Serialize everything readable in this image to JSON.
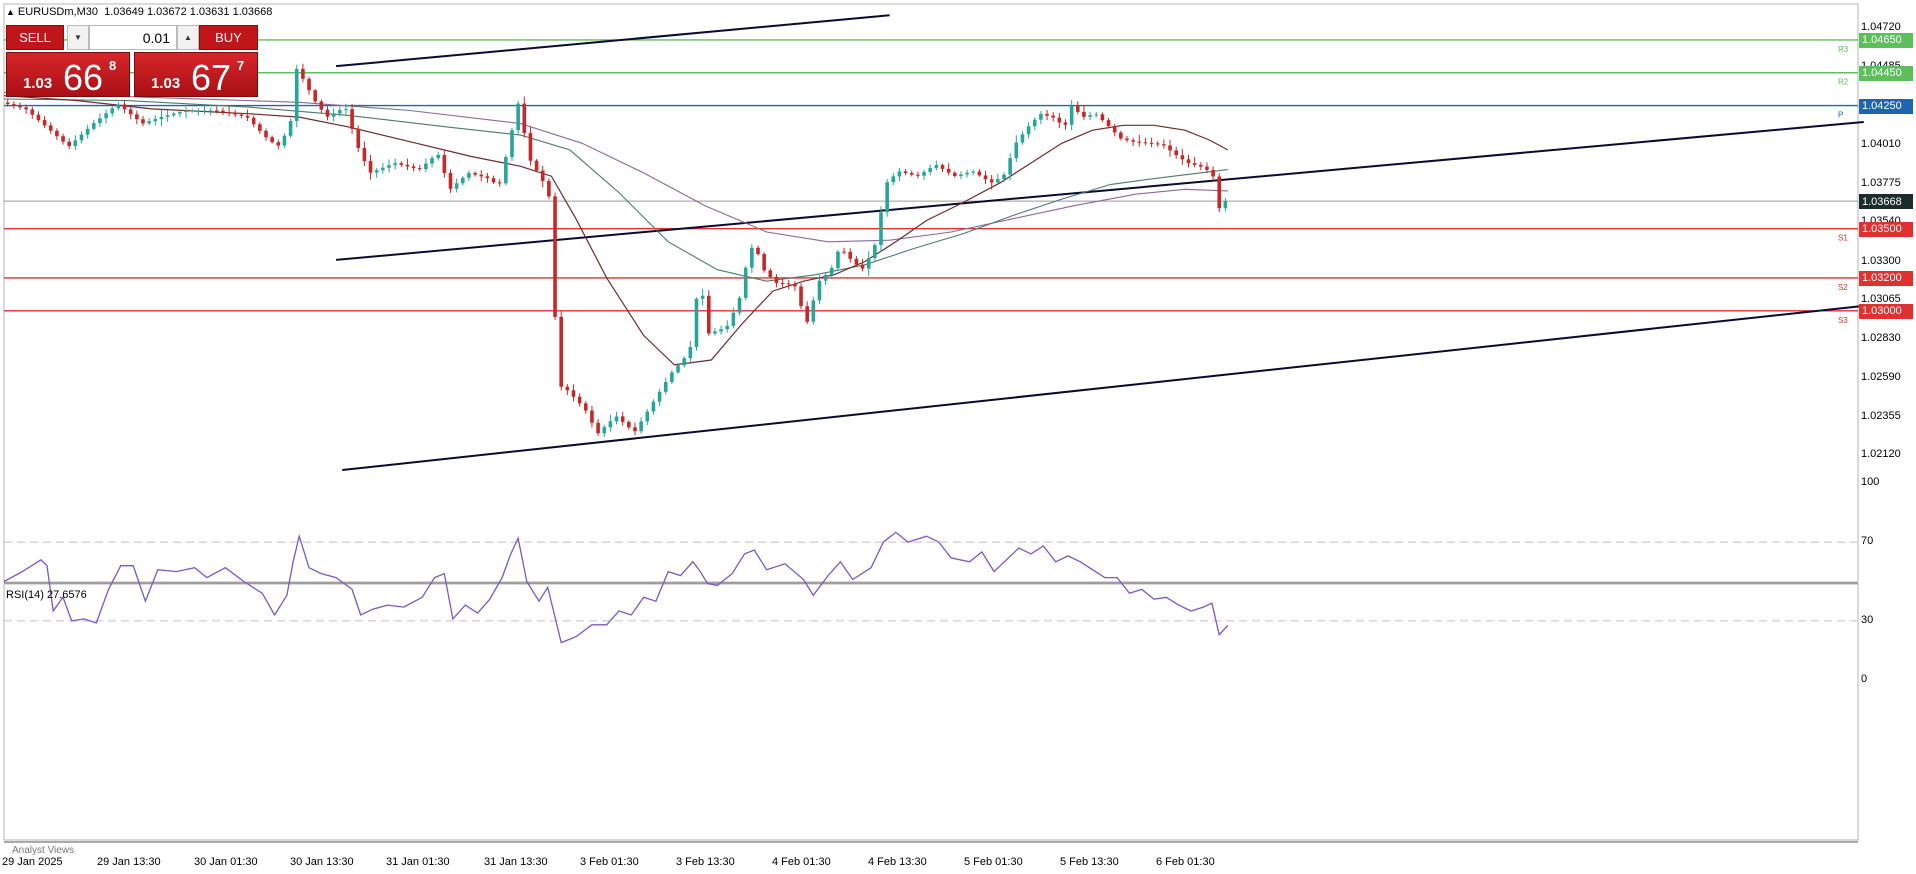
{
  "symbol": {
    "name_tf": "EURUSDm,M30",
    "ohlc": "1.03649 1.03672 1.03631 1.03668"
  },
  "trade_panel": {
    "sell_label": "SELL",
    "buy_label": "BUY",
    "volume": "0.01",
    "bid": {
      "pre": "1.03",
      "big": "66",
      "sup": "8"
    },
    "ask": {
      "pre": "1.03",
      "big": "67",
      "sup": "7"
    }
  },
  "colors": {
    "bull": "#26a69a",
    "bear": "#c62828",
    "resistance": "#5cbf5c",
    "pivot": "#1e64b4",
    "support": "#e03030",
    "channel": "#0a0a32",
    "rsi": "#7e57c2",
    "ma_fast": "#6d2b2b",
    "ma_mid": "#4e7a6c",
    "ma_slow": "#8a6a9a"
  },
  "price_axis": {
    "ticks": [
      "1.04720",
      "1.04485",
      "1.04010",
      "1.03775",
      "1.03540",
      "1.03300",
      "1.03065",
      "1.02830",
      "1.02590",
      "1.02355",
      "1.02120"
    ]
  },
  "levels": [
    {
      "price": 1.0465,
      "label": "1.04650",
      "kind": "resistance",
      "tag": "R3"
    },
    {
      "price": 1.0445,
      "label": "1.04450",
      "kind": "resistance",
      "tag": "R2"
    },
    {
      "price": 1.0425,
      "label": "1.04250",
      "kind": "pivot",
      "tag": "P"
    },
    {
      "price": 1.035,
      "label": "1.03500",
      "kind": "support",
      "tag": "S1"
    },
    {
      "price": 1.032,
      "label": "1.03200",
      "kind": "support",
      "tag": "S2"
    },
    {
      "price": 1.03,
      "label": "1.03000",
      "kind": "support",
      "tag": "S3"
    }
  ],
  "current_price": {
    "price": 1.03668,
    "label": "1.03668"
  },
  "time_axis": {
    "ticks": [
      "29 Jan 2025",
      "29 Jan 13:30",
      "30 Jan 01:30",
      "30 Jan 13:30",
      "31 Jan 01:30",
      "31 Jan 13:30",
      "3 Feb 01:30",
      "3 Feb 13:30",
      "4 Feb 01:30",
      "4 Feb 13:30",
      "5 Feb 01:30",
      "5 Feb 13:30",
      "6 Feb 01:30"
    ]
  },
  "rsi": {
    "label": "RSI(14) 27.6576",
    "axis_ticks": [
      "100",
      "70",
      "30",
      "0"
    ],
    "levels": [
      70,
      30
    ]
  },
  "footer": {
    "analyst_views": "Analyst Views"
  },
  "chart_data": {
    "type": "candlestick",
    "symbol": "EURUSDm",
    "timeframe": "M30",
    "ylim": [
      1.0203,
      1.0482
    ],
    "price_path": [
      [
        0,
        1.0427
      ],
      [
        20,
        1.0423
      ],
      [
        40,
        1.041
      ],
      [
        55,
        1.04
      ],
      [
        75,
        1.0414
      ],
      [
        95,
        1.0426
      ],
      [
        115,
        1.0414
      ],
      [
        130,
        1.0418
      ],
      [
        150,
        1.0422
      ],
      [
        175,
        1.0422
      ],
      [
        200,
        1.0418
      ],
      [
        215,
        1.0406
      ],
      [
        225,
        1.04
      ],
      [
        235,
        1.0412
      ],
      [
        240,
        1.0448
      ],
      [
        245,
        1.0442
      ],
      [
        255,
        1.0428
      ],
      [
        265,
        1.0418
      ],
      [
        280,
        1.0424
      ],
      [
        290,
        1.04
      ],
      [
        300,
        1.0384
      ],
      [
        320,
        1.039
      ],
      [
        340,
        1.0386
      ],
      [
        355,
        1.0396
      ],
      [
        365,
        1.0374
      ],
      [
        380,
        1.0384
      ],
      [
        395,
        1.0381
      ],
      [
        405,
        1.0376
      ],
      [
        415,
        1.0408
      ],
      [
        420,
        1.0428
      ],
      [
        430,
        1.0392
      ],
      [
        440,
        1.038
      ],
      [
        448,
        1.0365
      ],
      [
        452,
        1.0255
      ],
      [
        460,
        1.0252
      ],
      [
        475,
        1.024
      ],
      [
        485,
        1.0225
      ],
      [
        500,
        1.0236
      ],
      [
        515,
        1.0226
      ],
      [
        530,
        1.0244
      ],
      [
        545,
        1.0262
      ],
      [
        560,
        1.0275
      ],
      [
        568,
        1.0322
      ],
      [
        575,
        1.0286
      ],
      [
        590,
        1.029
      ],
      [
        600,
        1.0306
      ],
      [
        605,
        1.0325
      ],
      [
        612,
        1.0342
      ],
      [
        620,
        1.0325
      ],
      [
        630,
        1.0317
      ],
      [
        645,
        1.0316
      ],
      [
        655,
        1.0292
      ],
      [
        665,
        1.0318
      ],
      [
        675,
        1.0325
      ],
      [
        682,
        1.0339
      ],
      [
        690,
        1.0332
      ],
      [
        700,
        1.0325
      ],
      [
        710,
        1.0338
      ],
      [
        720,
        1.0378
      ],
      [
        730,
        1.0385
      ],
      [
        745,
        1.0382
      ],
      [
        760,
        1.0389
      ],
      [
        775,
        1.0382
      ],
      [
        790,
        1.0385
      ],
      [
        805,
        1.0378
      ],
      [
        815,
        1.0382
      ],
      [
        825,
        1.0402
      ],
      [
        835,
        1.0412
      ],
      [
        845,
        1.042
      ],
      [
        855,
        1.0418
      ],
      [
        865,
        1.0412
      ],
      [
        870,
        1.0425
      ],
      [
        880,
        1.0418
      ],
      [
        890,
        1.042
      ],
      [
        900,
        1.0413
      ],
      [
        910,
        1.0405
      ],
      [
        920,
        1.0403
      ],
      [
        935,
        1.0402
      ],
      [
        945,
        1.0401
      ],
      [
        955,
        1.0395
      ],
      [
        965,
        1.039
      ],
      [
        975,
        1.0388
      ],
      [
        985,
        1.0384
      ],
      [
        990,
        1.0362
      ],
      [
        995,
        1.03668
      ]
    ],
    "ma_fast": [
      [
        0,
        1.0431
      ],
      [
        60,
        1.0428
      ],
      [
        120,
        1.0423
      ],
      [
        200,
        1.042
      ],
      [
        240,
        1.0418
      ],
      [
        280,
        1.0412
      ],
      [
        330,
        1.0403
      ],
      [
        380,
        1.0394
      ],
      [
        420,
        1.0388
      ],
      [
        445,
        1.0382
      ],
      [
        465,
        1.0356
      ],
      [
        490,
        1.032
      ],
      [
        520,
        1.0285
      ],
      [
        545,
        1.0267
      ],
      [
        575,
        1.027
      ],
      [
        600,
        1.0292
      ],
      [
        625,
        1.0312
      ],
      [
        650,
        1.0318
      ],
      [
        675,
        1.0322
      ],
      [
        700,
        1.033
      ],
      [
        725,
        1.0342
      ],
      [
        750,
        1.0355
      ],
      [
        780,
        1.0366
      ],
      [
        810,
        1.0378
      ],
      [
        835,
        1.039
      ],
      [
        860,
        1.0402
      ],
      [
        885,
        1.041
      ],
      [
        910,
        1.0413
      ],
      [
        935,
        1.0413
      ],
      [
        960,
        1.041
      ],
      [
        980,
        1.0404
      ],
      [
        995,
        1.0398
      ]
    ],
    "ma_mid": [
      [
        0,
        1.0429
      ],
      [
        100,
        1.0428
      ],
      [
        200,
        1.0424
      ],
      [
        280,
        1.0419
      ],
      [
        360,
        1.0412
      ],
      [
        420,
        1.0407
      ],
      [
        460,
        1.0398
      ],
      [
        500,
        1.0372
      ],
      [
        540,
        1.0342
      ],
      [
        580,
        1.0325
      ],
      [
        620,
        1.0318
      ],
      [
        660,
        1.0322
      ],
      [
        700,
        1.0328
      ],
      [
        740,
        1.0338
      ],
      [
        780,
        1.0347
      ],
      [
        820,
        1.0358
      ],
      [
        860,
        1.0368
      ],
      [
        900,
        1.0377
      ],
      [
        940,
        1.0381
      ],
      [
        995,
        1.0386
      ]
    ],
    "ma_slow": [
      [
        0,
        1.0433
      ],
      [
        120,
        1.043
      ],
      [
        240,
        1.0427
      ],
      [
        330,
        1.0422
      ],
      [
        420,
        1.0414
      ],
      [
        470,
        1.0402
      ],
      [
        520,
        1.0384
      ],
      [
        570,
        1.0364
      ],
      [
        620,
        1.0348
      ],
      [
        670,
        1.0342
      ],
      [
        720,
        1.0343
      ],
      [
        770,
        1.0348
      ],
      [
        820,
        1.0356
      ],
      [
        870,
        1.0364
      ],
      [
        920,
        1.0371
      ],
      [
        960,
        1.0374
      ],
      [
        995,
        1.0373
      ]
    ],
    "channel_lines": [
      {
        "x1": 270,
        "y1": 1.0449,
        "x2": 720,
        "y2": 1.048
      },
      {
        "x1": 270,
        "y1": 1.0331,
        "x2": 1512,
        "y2": 1.0415
      },
      {
        "x1": 275,
        "y1": 1.0203,
        "x2": 1512,
        "y2": 1.0303
      }
    ],
    "rsi_path": [
      [
        0,
        50
      ],
      [
        15,
        55
      ],
      [
        30,
        61
      ],
      [
        35,
        58
      ],
      [
        40,
        35
      ],
      [
        48,
        42
      ],
      [
        55,
        30
      ],
      [
        65,
        31
      ],
      [
        75,
        29
      ],
      [
        85,
        46
      ],
      [
        95,
        58
      ],
      [
        105,
        58
      ],
      [
        115,
        40
      ],
      [
        125,
        56
      ],
      [
        140,
        55
      ],
      [
        155,
        57
      ],
      [
        165,
        52
      ],
      [
        180,
        57
      ],
      [
        195,
        50
      ],
      [
        210,
        44
      ],
      [
        220,
        33
      ],
      [
        230,
        43
      ],
      [
        235,
        60
      ],
      [
        240,
        73
      ],
      [
        248,
        57
      ],
      [
        258,
        54
      ],
      [
        270,
        52
      ],
      [
        283,
        46
      ],
      [
        290,
        33
      ],
      [
        300,
        36
      ],
      [
        312,
        38
      ],
      [
        325,
        37
      ],
      [
        340,
        42
      ],
      [
        350,
        52
      ],
      [
        358,
        54
      ],
      [
        365,
        31
      ],
      [
        375,
        38
      ],
      [
        385,
        34
      ],
      [
        395,
        41
      ],
      [
        405,
        52
      ],
      [
        412,
        64
      ],
      [
        418,
        72
      ],
      [
        425,
        50
      ],
      [
        435,
        40
      ],
      [
        442,
        47
      ],
      [
        448,
        32
      ],
      [
        453,
        19
      ],
      [
        465,
        22
      ],
      [
        478,
        28
      ],
      [
        490,
        28
      ],
      [
        500,
        35
      ],
      [
        510,
        33
      ],
      [
        520,
        42
      ],
      [
        530,
        40
      ],
      [
        540,
        55
      ],
      [
        550,
        53
      ],
      [
        560,
        60
      ],
      [
        565,
        56
      ],
      [
        572,
        49
      ],
      [
        580,
        48
      ],
      [
        592,
        54
      ],
      [
        602,
        64
      ],
      [
        610,
        66
      ],
      [
        620,
        56
      ],
      [
        635,
        59
      ],
      [
        650,
        51
      ],
      [
        658,
        43
      ],
      [
        670,
        53
      ],
      [
        680,
        60
      ],
      [
        690,
        51
      ],
      [
        705,
        57
      ],
      [
        715,
        70
      ],
      [
        725,
        75
      ],
      [
        735,
        70
      ],
      [
        750,
        73
      ],
      [
        760,
        70
      ],
      [
        770,
        62
      ],
      [
        785,
        60
      ],
      [
        795,
        65
      ],
      [
        805,
        55
      ],
      [
        815,
        61
      ],
      [
        825,
        67
      ],
      [
        835,
        64
      ],
      [
        845,
        68
      ],
      [
        855,
        60
      ],
      [
        865,
        63
      ],
      [
        875,
        60
      ],
      [
        885,
        56
      ],
      [
        895,
        52
      ],
      [
        905,
        52
      ],
      [
        915,
        44
      ],
      [
        925,
        46
      ],
      [
        935,
        41
      ],
      [
        945,
        42
      ],
      [
        955,
        38
      ],
      [
        965,
        35
      ],
      [
        975,
        37
      ],
      [
        982,
        39
      ],
      [
        988,
        23
      ],
      [
        995,
        27.66
      ]
    ]
  }
}
